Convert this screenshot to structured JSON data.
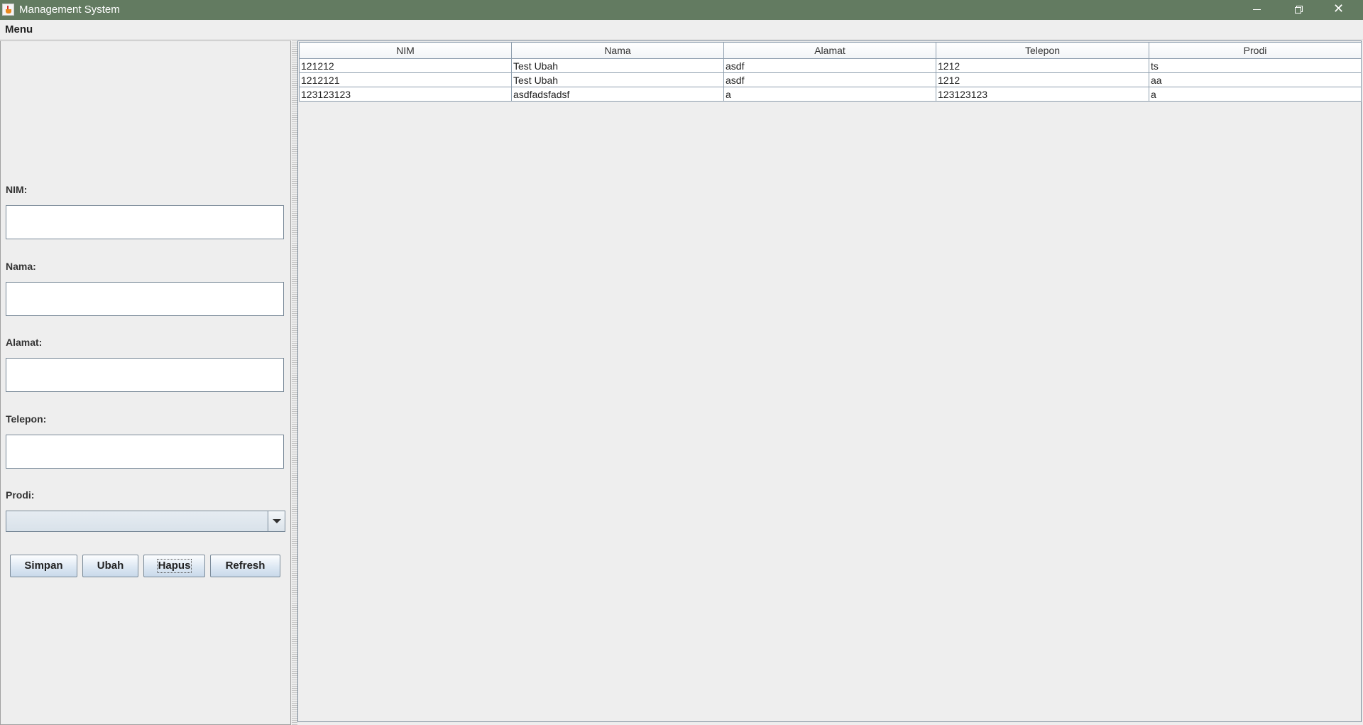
{
  "window": {
    "title": "Management System"
  },
  "menubar": {
    "items": [
      "Menu"
    ]
  },
  "form": {
    "nim_label": "NIM:",
    "nim_value": "",
    "nama_label": "Nama:",
    "nama_value": "",
    "alamat_label": "Alamat:",
    "alamat_value": "",
    "telepon_label": "Telepon:",
    "telepon_value": "",
    "prodi_label": "Prodi:",
    "prodi_selected": ""
  },
  "buttons": {
    "simpan": "Simpan",
    "ubah": "Ubah",
    "hapus": "Hapus",
    "refresh": "Refresh"
  },
  "table": {
    "columns": [
      "NIM",
      "Nama",
      "Alamat",
      "Telepon",
      "Prodi"
    ],
    "rows": [
      [
        "121212",
        "Test Ubah",
        "asdf",
        "1212",
        "ts"
      ],
      [
        "1212121",
        "Test Ubah",
        "asdf",
        "1212",
        "aa"
      ],
      [
        "123123123",
        "asdfadsfadsf",
        "a",
        "123123123",
        "a"
      ]
    ]
  },
  "icons": {
    "app": "java-cup-icon",
    "minimize": "minimize-icon",
    "maximize": "restore-icon",
    "close": "close-icon",
    "combo": "chevron-down-icon"
  },
  "colors": {
    "titlebar": "#637b61",
    "background": "#eeeeee",
    "button_gradient_bottom": "#c9d9ea"
  }
}
